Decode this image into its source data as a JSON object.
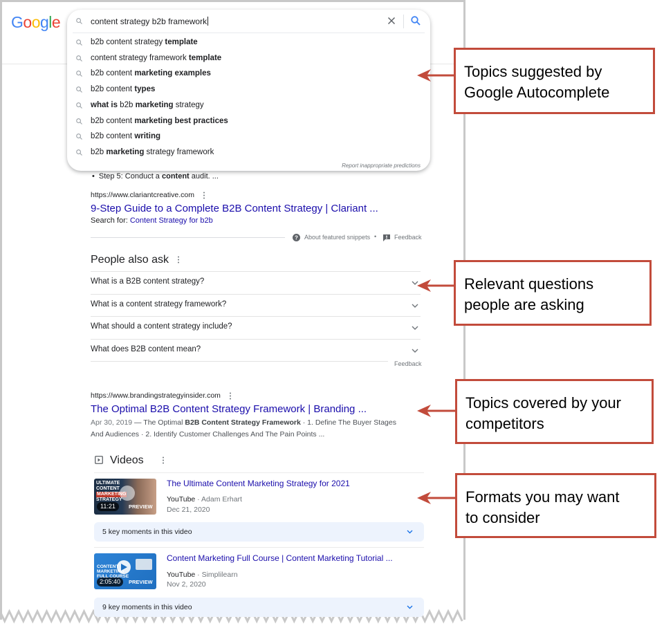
{
  "logo": {
    "letters": [
      "G",
      "o",
      "o",
      "g",
      "l",
      "e"
    ],
    "colors": [
      "#4285f4",
      "#ea4335",
      "#fbbc05",
      "#4285f4",
      "#34a853",
      "#ea4335"
    ]
  },
  "search": {
    "query": "content strategy b2b framework",
    "suggestions": [
      {
        "parts": [
          {
            "t": "b2b content strategy ",
            "b": false
          },
          {
            "t": "template",
            "b": true
          }
        ]
      },
      {
        "parts": [
          {
            "t": "content strategy framework ",
            "b": false
          },
          {
            "t": "template",
            "b": true
          }
        ]
      },
      {
        "parts": [
          {
            "t": "b2b content ",
            "b": false
          },
          {
            "t": "marketing examples",
            "b": true
          }
        ]
      },
      {
        "parts": [
          {
            "t": "b2b content ",
            "b": false
          },
          {
            "t": "types",
            "b": true
          }
        ]
      },
      {
        "parts": [
          {
            "t": "what is",
            "b": true
          },
          {
            "t": " b2b ",
            "b": false
          },
          {
            "t": "marketing",
            "b": true
          },
          {
            "t": " strategy",
            "b": false
          }
        ]
      },
      {
        "parts": [
          {
            "t": "b2b content ",
            "b": false
          },
          {
            "t": "marketing best practices",
            "b": true
          }
        ]
      },
      {
        "parts": [
          {
            "t": "b2b content ",
            "b": false
          },
          {
            "t": "writing",
            "b": true
          }
        ]
      },
      {
        "parts": [
          {
            "t": "b2b ",
            "b": false
          },
          {
            "t": "marketing",
            "b": true
          },
          {
            "t": " strategy framework",
            "b": false
          }
        ]
      }
    ],
    "report_label": "Report inappropriate predictions"
  },
  "featured": {
    "bullet_pre": "Step 5: Conduct a ",
    "bullet_bold": "content",
    "bullet_post": " audit. ...",
    "url": "https://www.clariantcreative.com",
    "title": "9-Step Guide to a Complete B2B Content Strategy | Clariant ...",
    "search_for_label": "Search for: ",
    "search_for_link": "Content Strategy for b2b",
    "about_label": "About featured snippets",
    "separator": "•",
    "feedback_label": "Feedback"
  },
  "paa": {
    "title": "People also ask",
    "questions": [
      "What is a B2B content strategy?",
      "What is a content strategy framework?",
      "What should a content strategy include?",
      "What does B2B content mean?"
    ],
    "feedback_label": "Feedback"
  },
  "result2": {
    "url": "https://www.brandingstrategyinsider.com",
    "title": "The Optimal B2B Content Strategy Framework | Branding ...",
    "date": "Apr 30, 2019",
    "snippet_pre": " — The Optimal ",
    "snippet_bold": "B2B Content Strategy Framework",
    "snippet_post": " · 1. Define The Buyer Stages",
    "snippet_line2": "And Audiences · 2. Identify Customer Challenges And The Pain Points ..."
  },
  "videos": {
    "title": "Videos",
    "items": [
      {
        "title": "The Ultimate Content Marketing Strategy for 2021",
        "source": "YouTube",
        "author": " · Adam Erhart",
        "date": "Dec 21, 2020",
        "duration": "11:21",
        "preview": "PREVIEW",
        "thumb_text": [
          "ULTIMATE",
          "CONTENT",
          "MARKETING",
          "STRATEGY"
        ],
        "key_moments": "5 key moments in this video"
      },
      {
        "title": "Content Marketing Full Course | Content Marketing Tutorial ...",
        "source": "YouTube",
        "author": " · Simplilearn",
        "date": "Nov 2, 2020",
        "duration": "2:05:40",
        "preview": "PREVIEW",
        "thumb_text": [
          "CONTENT",
          "MARKETING",
          "FULL COURSE"
        ],
        "key_moments": "9 key moments in this video"
      }
    ]
  },
  "annotations": [
    {
      "line1": "Topics suggested by",
      "line2": "Google Autocomplete"
    },
    {
      "line1": "Relevant questions",
      "line2": "people are asking"
    },
    {
      "line1": "Topics covered by your",
      "line2": "competitors"
    },
    {
      "line1": "Formats you may want",
      "line2": "to consider"
    }
  ],
  "colors": {
    "annotation": "#c24b3b",
    "link": "#1a0dab",
    "google_blue": "#4285f4",
    "key_moments_bg": "#edf3fd"
  }
}
